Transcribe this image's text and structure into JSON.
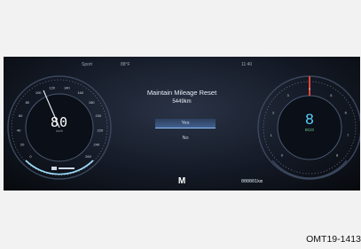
{
  "cluster": {
    "top_left_status": "Sport",
    "top_mid_status": "88°F",
    "top_right_status": "11:40",
    "menu": {
      "title": "Maintain Mileage Reset",
      "value": "5449km",
      "options": [
        "Yes",
        "No"
      ],
      "selected": "Yes"
    },
    "speedometer": {
      "value": "80",
      "unit": "km/h",
      "ticks": [
        "0",
        "20",
        "40",
        "60",
        "80",
        "100",
        "120",
        "140",
        "160",
        "180",
        "200",
        "220",
        "240",
        "260"
      ]
    },
    "tachometer": {
      "gear": "8",
      "mode": "ECO",
      "ticks": [
        "0",
        "1",
        "2",
        "3",
        "4",
        "5",
        "6",
        "7",
        "8"
      ]
    },
    "logo": "M",
    "odometer": "000001km",
    "accent_color": "#58d6ff",
    "needle_color": "#ff4a3a"
  },
  "caption": "OMT19-1413"
}
